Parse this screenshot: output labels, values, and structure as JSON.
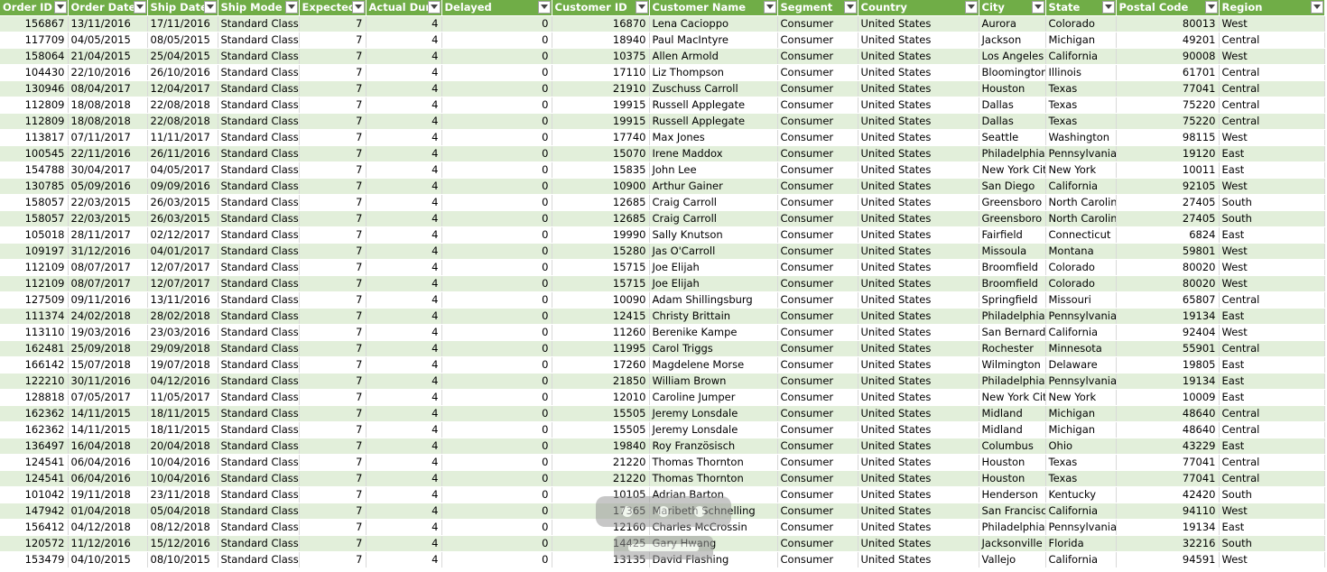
{
  "columns": [
    {
      "key": "order_id",
      "label": "Order ID",
      "align": "num"
    },
    {
      "key": "order_date",
      "label": "Order Date",
      "align": "txt"
    },
    {
      "key": "ship_date",
      "label": "Ship Date",
      "align": "txt"
    },
    {
      "key": "ship_mode",
      "label": "Ship Mode",
      "align": "txt"
    },
    {
      "key": "expected",
      "label": "Expected",
      "align": "num"
    },
    {
      "key": "actual",
      "label": "Actual Dura",
      "align": "num"
    },
    {
      "key": "delayed",
      "label": "Delayed",
      "align": "num"
    },
    {
      "key": "customer_id",
      "label": "Customer ID",
      "align": "num"
    },
    {
      "key": "customer_name",
      "label": "Customer Name",
      "align": "txt"
    },
    {
      "key": "segment",
      "label": "Segment",
      "align": "txt"
    },
    {
      "key": "country",
      "label": "Country",
      "align": "txt"
    },
    {
      "key": "city",
      "label": "City",
      "align": "txt"
    },
    {
      "key": "state",
      "label": "State",
      "align": "txt"
    },
    {
      "key": "postal",
      "label": "Postal Code",
      "align": "num"
    },
    {
      "key": "region",
      "label": "Region",
      "align": "txt"
    }
  ],
  "rows": [
    [
      "156867",
      "13/11/2016",
      "17/11/2016",
      "Standard Class",
      "7",
      "4",
      "0",
      "16870",
      "Lena Cacioppo",
      "Consumer",
      "United States",
      "Aurora",
      "Colorado",
      "80013",
      "West"
    ],
    [
      "117709",
      "04/05/2015",
      "08/05/2015",
      "Standard Class",
      "7",
      "4",
      "0",
      "18940",
      "Paul MacIntyre",
      "Consumer",
      "United States",
      "Jackson",
      "Michigan",
      "49201",
      "Central"
    ],
    [
      "158064",
      "21/04/2015",
      "25/04/2015",
      "Standard Class",
      "7",
      "4",
      "0",
      "10375",
      "Allen Armold",
      "Consumer",
      "United States",
      "Los Angeles",
      "California",
      "90008",
      "West"
    ],
    [
      "104430",
      "22/10/2016",
      "26/10/2016",
      "Standard Class",
      "7",
      "4",
      "0",
      "17110",
      "Liz Thompson",
      "Consumer",
      "United States",
      "Bloomington",
      "Illinois",
      "61701",
      "Central"
    ],
    [
      "130946",
      "08/04/2017",
      "12/04/2017",
      "Standard Class",
      "7",
      "4",
      "0",
      "21910",
      "Zuschuss Carroll",
      "Consumer",
      "United States",
      "Houston",
      "Texas",
      "77041",
      "Central"
    ],
    [
      "112809",
      "18/08/2018",
      "22/08/2018",
      "Standard Class",
      "7",
      "4",
      "0",
      "19915",
      "Russell Applegate",
      "Consumer",
      "United States",
      "Dallas",
      "Texas",
      "75220",
      "Central"
    ],
    [
      "112809",
      "18/08/2018",
      "22/08/2018",
      "Standard Class",
      "7",
      "4",
      "0",
      "19915",
      "Russell Applegate",
      "Consumer",
      "United States",
      "Dallas",
      "Texas",
      "75220",
      "Central"
    ],
    [
      "113817",
      "07/11/2017",
      "11/11/2017",
      "Standard Class",
      "7",
      "4",
      "0",
      "17740",
      "Max Jones",
      "Consumer",
      "United States",
      "Seattle",
      "Washington",
      "98115",
      "West"
    ],
    [
      "100545",
      "22/11/2016",
      "26/11/2016",
      "Standard Class",
      "7",
      "4",
      "0",
      "15070",
      "Irene Maddox",
      "Consumer",
      "United States",
      "Philadelphia",
      "Pennsylvania",
      "19120",
      "East"
    ],
    [
      "154788",
      "30/04/2017",
      "04/05/2017",
      "Standard Class",
      "7",
      "4",
      "0",
      "15835",
      "John Lee",
      "Consumer",
      "United States",
      "New York City",
      "New York",
      "10011",
      "East"
    ],
    [
      "130785",
      "05/09/2016",
      "09/09/2016",
      "Standard Class",
      "7",
      "4",
      "0",
      "10900",
      "Arthur Gainer",
      "Consumer",
      "United States",
      "San Diego",
      "California",
      "92105",
      "West"
    ],
    [
      "158057",
      "22/03/2015",
      "26/03/2015",
      "Standard Class",
      "7",
      "4",
      "0",
      "12685",
      "Craig Carroll",
      "Consumer",
      "United States",
      "Greensboro",
      "North Carolina",
      "27405",
      "South"
    ],
    [
      "158057",
      "22/03/2015",
      "26/03/2015",
      "Standard Class",
      "7",
      "4",
      "0",
      "12685",
      "Craig Carroll",
      "Consumer",
      "United States",
      "Greensboro",
      "North Carolina",
      "27405",
      "South"
    ],
    [
      "105018",
      "28/11/2017",
      "02/12/2017",
      "Standard Class",
      "7",
      "4",
      "0",
      "19990",
      "Sally Knutson",
      "Consumer",
      "United States",
      "Fairfield",
      "Connecticut",
      "6824",
      "East"
    ],
    [
      "109197",
      "31/12/2016",
      "04/01/2017",
      "Standard Class",
      "7",
      "4",
      "0",
      "15280",
      "Jas O'Carroll",
      "Consumer",
      "United States",
      "Missoula",
      "Montana",
      "59801",
      "West"
    ],
    [
      "112109",
      "08/07/2017",
      "12/07/2017",
      "Standard Class",
      "7",
      "4",
      "0",
      "15715",
      "Joe Elijah",
      "Consumer",
      "United States",
      "Broomfield",
      "Colorado",
      "80020",
      "West"
    ],
    [
      "112109",
      "08/07/2017",
      "12/07/2017",
      "Standard Class",
      "7",
      "4",
      "0",
      "15715",
      "Joe Elijah",
      "Consumer",
      "United States",
      "Broomfield",
      "Colorado",
      "80020",
      "West"
    ],
    [
      "127509",
      "09/11/2016",
      "13/11/2016",
      "Standard Class",
      "7",
      "4",
      "0",
      "10090",
      "Adam Shillingsburg",
      "Consumer",
      "United States",
      "Springfield",
      "Missouri",
      "65807",
      "Central"
    ],
    [
      "111374",
      "24/02/2018",
      "28/02/2018",
      "Standard Class",
      "7",
      "4",
      "0",
      "12415",
      "Christy Brittain",
      "Consumer",
      "United States",
      "Philadelphia",
      "Pennsylvania",
      "19134",
      "East"
    ],
    [
      "113110",
      "19/03/2016",
      "23/03/2016",
      "Standard Class",
      "7",
      "4",
      "0",
      "11260",
      "Berenike Kampe",
      "Consumer",
      "United States",
      "San Bernardino",
      "California",
      "92404",
      "West"
    ],
    [
      "162481",
      "25/09/2018",
      "29/09/2018",
      "Standard Class",
      "7",
      "4",
      "0",
      "11995",
      "Carol Triggs",
      "Consumer",
      "United States",
      "Rochester",
      "Minnesota",
      "55901",
      "Central"
    ],
    [
      "166142",
      "15/07/2018",
      "19/07/2018",
      "Standard Class",
      "7",
      "4",
      "0",
      "17260",
      "Magdelene Morse",
      "Consumer",
      "United States",
      "Wilmington",
      "Delaware",
      "19805",
      "East"
    ],
    [
      "122210",
      "30/11/2016",
      "04/12/2016",
      "Standard Class",
      "7",
      "4",
      "0",
      "21850",
      "William Brown",
      "Consumer",
      "United States",
      "Philadelphia",
      "Pennsylvania",
      "19134",
      "East"
    ],
    [
      "128818",
      "07/05/2017",
      "11/05/2017",
      "Standard Class",
      "7",
      "4",
      "0",
      "12010",
      "Caroline Jumper",
      "Consumer",
      "United States",
      "New York City",
      "New York",
      "10009",
      "East"
    ],
    [
      "162362",
      "14/11/2015",
      "18/11/2015",
      "Standard Class",
      "7",
      "4",
      "0",
      "15505",
      "Jeremy Lonsdale",
      "Consumer",
      "United States",
      "Midland",
      "Michigan",
      "48640",
      "Central"
    ],
    [
      "162362",
      "14/11/2015",
      "18/11/2015",
      "Standard Class",
      "7",
      "4",
      "0",
      "15505",
      "Jeremy Lonsdale",
      "Consumer",
      "United States",
      "Midland",
      "Michigan",
      "48640",
      "Central"
    ],
    [
      "136497",
      "16/04/2018",
      "20/04/2018",
      "Standard Class",
      "7",
      "4",
      "0",
      "19840",
      "Roy Französisch",
      "Consumer",
      "United States",
      "Columbus",
      "Ohio",
      "43229",
      "East"
    ],
    [
      "124541",
      "06/04/2016",
      "10/04/2016",
      "Standard Class",
      "7",
      "4",
      "0",
      "21220",
      "Thomas Thornton",
      "Consumer",
      "United States",
      "Houston",
      "Texas",
      "77041",
      "Central"
    ],
    [
      "124541",
      "06/04/2016",
      "10/04/2016",
      "Standard Class",
      "7",
      "4",
      "0",
      "21220",
      "Thomas Thornton",
      "Consumer",
      "United States",
      "Houston",
      "Texas",
      "77041",
      "Central"
    ],
    [
      "101042",
      "19/11/2018",
      "23/11/2018",
      "Standard Class",
      "7",
      "4",
      "0",
      "10105",
      "Adrian Barton",
      "Consumer",
      "United States",
      "Henderson",
      "Kentucky",
      "42420",
      "South"
    ],
    [
      "147942",
      "01/04/2018",
      "05/04/2018",
      "Standard Class",
      "7",
      "4",
      "0",
      "17365",
      "Maribeth Schnelling",
      "Consumer",
      "United States",
      "San Francisco",
      "California",
      "94110",
      "West"
    ],
    [
      "156412",
      "04/12/2018",
      "08/12/2018",
      "Standard Class",
      "7",
      "4",
      "0",
      "12160",
      "Charles McCrossin",
      "Consumer",
      "United States",
      "Philadelphia",
      "Pennsylvania",
      "19134",
      "East"
    ],
    [
      "120572",
      "11/12/2016",
      "15/12/2016",
      "Standard Class",
      "7",
      "4",
      "0",
      "14425",
      "Gary Hwang",
      "Consumer",
      "United States",
      "Jacksonville",
      "Florida",
      "32216",
      "South"
    ],
    [
      "153479",
      "04/10/2015",
      "08/10/2015",
      "Standard Class",
      "7",
      "4",
      "0",
      "13135",
      "David Flashing",
      "Consumer",
      "United States",
      "Vallejo",
      "California",
      "94591",
      "West"
    ]
  ],
  "colors": {
    "header": "#70ad47",
    "band": "#e2efda",
    "plain": "#ffffff"
  },
  "icons": {
    "filter": "filter-dropdown-icon",
    "watermark": "site-watermark-logo"
  }
}
